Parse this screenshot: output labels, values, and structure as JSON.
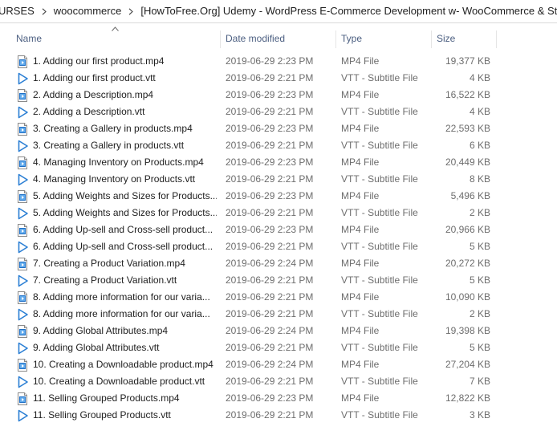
{
  "breadcrumb": {
    "items": [
      "URSES",
      "woocommerce",
      "[HowToFree.Org] Udemy - WordPress E-Commerce Development w- WooCommerce & Storefront"
    ]
  },
  "columns": {
    "name": "Name",
    "date_modified": "Date modified",
    "type": "Type",
    "size": "Size"
  },
  "sort": {
    "column": "name",
    "direction": "ascending"
  },
  "files": [
    {
      "name": "1. Adding our first product.mp4",
      "date": "2019-06-29 2:23 PM",
      "type": "MP4 File",
      "size": "19,377 KB",
      "icon": "mp4-file-icon"
    },
    {
      "name": "1. Adding our first product.vtt",
      "date": "2019-06-29 2:21 PM",
      "type": "VTT - Subtitle File",
      "size": "4 KB",
      "icon": "vtt-file-icon"
    },
    {
      "name": "2. Adding a Description.mp4",
      "date": "2019-06-29 2:23 PM",
      "type": "MP4 File",
      "size": "16,522 KB",
      "icon": "mp4-file-icon"
    },
    {
      "name": "2. Adding a Description.vtt",
      "date": "2019-06-29 2:21 PM",
      "type": "VTT - Subtitle File",
      "size": "4 KB",
      "icon": "vtt-file-icon"
    },
    {
      "name": "3. Creating a Gallery in products.mp4",
      "date": "2019-06-29 2:23 PM",
      "type": "MP4 File",
      "size": "22,593 KB",
      "icon": "mp4-file-icon"
    },
    {
      "name": "3. Creating a Gallery in products.vtt",
      "date": "2019-06-29 2:21 PM",
      "type": "VTT - Subtitle File",
      "size": "6 KB",
      "icon": "vtt-file-icon"
    },
    {
      "name": "4. Managing Inventory on Products.mp4",
      "date": "2019-06-29 2:23 PM",
      "type": "MP4 File",
      "size": "20,449 KB",
      "icon": "mp4-file-icon"
    },
    {
      "name": "4. Managing Inventory on Products.vtt",
      "date": "2019-06-29 2:21 PM",
      "type": "VTT - Subtitle File",
      "size": "8 KB",
      "icon": "vtt-file-icon"
    },
    {
      "name": "5. Adding Weights and Sizes for Products...",
      "date": "2019-06-29 2:23 PM",
      "type": "MP4 File",
      "size": "5,496 KB",
      "icon": "mp4-file-icon"
    },
    {
      "name": "5. Adding Weights and Sizes for Products...",
      "date": "2019-06-29 2:21 PM",
      "type": "VTT - Subtitle File",
      "size": "2 KB",
      "icon": "vtt-file-icon"
    },
    {
      "name": "6. Adding Up-sell and Cross-sell product...",
      "date": "2019-06-29 2:23 PM",
      "type": "MP4 File",
      "size": "20,966 KB",
      "icon": "mp4-file-icon"
    },
    {
      "name": "6. Adding Up-sell and Cross-sell product...",
      "date": "2019-06-29 2:21 PM",
      "type": "VTT - Subtitle File",
      "size": "5 KB",
      "icon": "vtt-file-icon"
    },
    {
      "name": "7. Creating a Product Variation.mp4",
      "date": "2019-06-29 2:24 PM",
      "type": "MP4 File",
      "size": "20,272 KB",
      "icon": "mp4-file-icon"
    },
    {
      "name": "7. Creating a Product Variation.vtt",
      "date": "2019-06-29 2:21 PM",
      "type": "VTT - Subtitle File",
      "size": "5 KB",
      "icon": "vtt-file-icon"
    },
    {
      "name": "8. Adding more information for our varia...",
      "date": "2019-06-29 2:21 PM",
      "type": "MP4 File",
      "size": "10,090 KB",
      "icon": "mp4-file-icon"
    },
    {
      "name": "8. Adding more information for our varia...",
      "date": "2019-06-29 2:21 PM",
      "type": "VTT - Subtitle File",
      "size": "2 KB",
      "icon": "vtt-file-icon"
    },
    {
      "name": "9. Adding Global Attributes.mp4",
      "date": "2019-06-29 2:24 PM",
      "type": "MP4 File",
      "size": "19,398 KB",
      "icon": "mp4-file-icon"
    },
    {
      "name": "9. Adding Global Attributes.vtt",
      "date": "2019-06-29 2:21 PM",
      "type": "VTT - Subtitle File",
      "size": "5 KB",
      "icon": "vtt-file-icon"
    },
    {
      "name": "10. Creating a Downloadable product.mp4",
      "date": "2019-06-29 2:24 PM",
      "type": "MP4 File",
      "size": "27,204 KB",
      "icon": "mp4-file-icon"
    },
    {
      "name": "10. Creating a Downloadable product.vtt",
      "date": "2019-06-29 2:21 PM",
      "type": "VTT - Subtitle File",
      "size": "7 KB",
      "icon": "vtt-file-icon"
    },
    {
      "name": "11. Selling Grouped Products.mp4",
      "date": "2019-06-29 2:23 PM",
      "type": "MP4 File",
      "size": "12,822 KB",
      "icon": "mp4-file-icon"
    },
    {
      "name": "11. Selling Grouped Products.vtt",
      "date": "2019-06-29 2:21 PM",
      "type": "VTT - Subtitle File",
      "size": "3 KB",
      "icon": "vtt-file-icon"
    }
  ],
  "colors": {
    "header_text": "#4d6082",
    "name_text": "#1e1e1e",
    "detail_text": "#6d6d6d",
    "vtt_icon_blue": "#2b7fd4",
    "mp4_icon_blue": "#1f6fc5"
  }
}
